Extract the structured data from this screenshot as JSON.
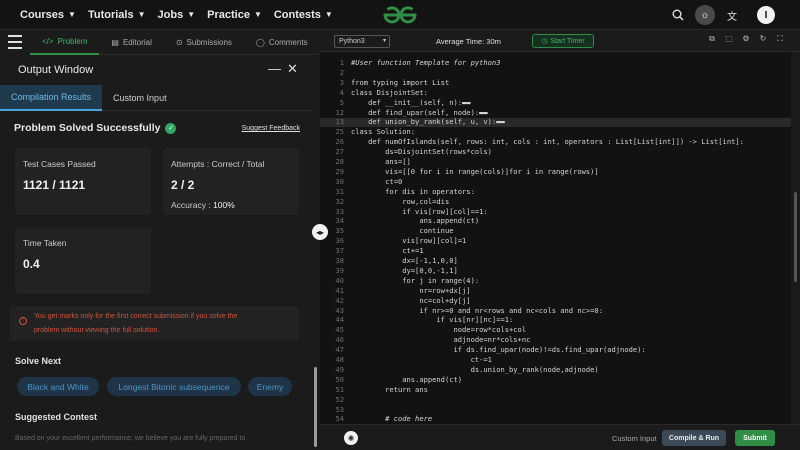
{
  "nav": {
    "items": [
      {
        "label": "Courses"
      },
      {
        "label": "Tutorials"
      },
      {
        "label": "Jobs"
      },
      {
        "label": "Practice"
      },
      {
        "label": "Contests"
      }
    ],
    "avatar_initial": "I",
    "logo_color": "#2f8d46"
  },
  "tabs": [
    {
      "label": "Problem",
      "active": true
    },
    {
      "label": "Editorial"
    },
    {
      "label": "Submissions"
    },
    {
      "label": "Comments"
    }
  ],
  "output": {
    "title": "Output Window",
    "subtabs": [
      {
        "label": "Compilation Results",
        "active": true
      },
      {
        "label": "Custom Input"
      }
    ],
    "status": "Problem Solved Successfully",
    "feedback": "Suggest Feedback",
    "test_cases_label": "Test Cases Passed",
    "test_cases_value": "1121 / 1121",
    "attempts_label": "Attempts : Correct / Total",
    "attempts_value": "2 / 2",
    "accuracy_label": "Accuracy :",
    "accuracy_value": "100%",
    "time_label": "Time Taken",
    "time_value": "0.4",
    "warning_line1": "You get marks only for the first correct submission if you solve the",
    "warning_line2": "problem without viewing the full solution.",
    "solve_next_title": "Solve Next",
    "solve_next": [
      "Black and White",
      "Longest Bitonic subsequence",
      "Enemy"
    ],
    "suggested_title": "Suggested Contest",
    "suggested_text": "Based on your excellent performance, we believe you are fully prepared to"
  },
  "editor": {
    "language": "Python3",
    "avg_time": "Average Time: 30m",
    "timer_label": "Start Timer",
    "lines": [
      {
        "n": "1",
        "text": "#User function Template for python3",
        "comment": true
      },
      {
        "n": "2",
        "text": ""
      },
      {
        "n": "3",
        "text": "from typing import List"
      },
      {
        "n": "4",
        "text": "class DisjointSet:"
      },
      {
        "n": "5",
        "text": "    def __init__(self, n):▬▬"
      },
      {
        "n": "12",
        "text": "    def find_upar(self, node):▬▬"
      },
      {
        "n": "13",
        "text": "    def union_by_rank(self, u, v):▬▬",
        "highlight": true
      },
      {
        "n": "25",
        "text": "class Solution:"
      },
      {
        "n": "26",
        "text": "    def numOfIslands(self, rows: int, cols : int, operators : List[List[int]]) -> List[int]:"
      },
      {
        "n": "27",
        "text": "        ds=DisjointSet(rows*cols)"
      },
      {
        "n": "28",
        "text": "        ans=[]"
      },
      {
        "n": "29",
        "text": "        vis=[[0 for i in range(cols)]for i in range(rows)]"
      },
      {
        "n": "30",
        "text": "        ct=0"
      },
      {
        "n": "31",
        "text": "        for dis in operators:"
      },
      {
        "n": "32",
        "text": "            row,col=dis"
      },
      {
        "n": "33",
        "text": "            if vis[row][col]==1:"
      },
      {
        "n": "34",
        "text": "                ans.append(ct)"
      },
      {
        "n": "35",
        "text": "                continue"
      },
      {
        "n": "36",
        "text": "            vis[row][col]=1"
      },
      {
        "n": "37",
        "text": "            ct+=1"
      },
      {
        "n": "38",
        "text": "            dx=[-1,1,0,0]"
      },
      {
        "n": "39",
        "text": "            dy=[0,0,-1,1]"
      },
      {
        "n": "40",
        "text": "            for j in range(4):"
      },
      {
        "n": "41",
        "text": "                nr=row+dx[j]"
      },
      {
        "n": "42",
        "text": "                nc=col+dy[j]"
      },
      {
        "n": "43",
        "text": "                if nr>=0 and nr<rows and nc<cols and nc>=0:"
      },
      {
        "n": "44",
        "text": "                    if vis[nr][nc]==1:"
      },
      {
        "n": "45",
        "text": "                        node=row*cols+col"
      },
      {
        "n": "46",
        "text": "                        adjnode=nr*cols+nc"
      },
      {
        "n": "47",
        "text": "                        if ds.find_upar(node)!=ds.find_upar(adjnode):"
      },
      {
        "n": "48",
        "text": "                            ct-=1"
      },
      {
        "n": "49",
        "text": "                            ds.union_by_rank(node,adjnode)"
      },
      {
        "n": "50",
        "text": "            ans.append(ct)"
      },
      {
        "n": "51",
        "text": "        return ans"
      },
      {
        "n": "52",
        "text": ""
      },
      {
        "n": "53",
        "text": ""
      },
      {
        "n": "54",
        "text": "        # code here",
        "comment": true
      },
      {
        "n": "55",
        "text": ""
      }
    ]
  },
  "bottom": {
    "custom_input": "Custom Input",
    "compile_run": "Compile & Run",
    "submit": "Submit"
  }
}
